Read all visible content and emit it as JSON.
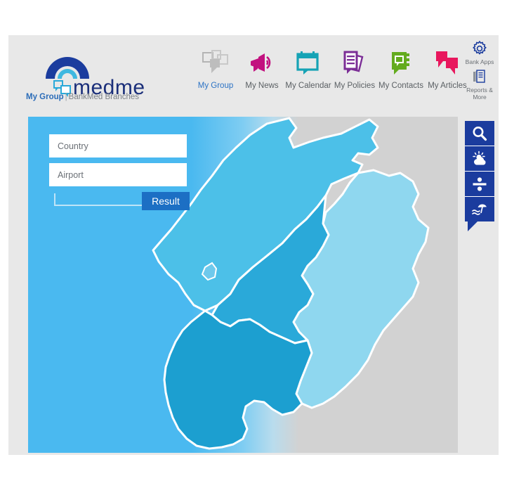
{
  "brand": {
    "name": "medme",
    "logo_icon": "arc-logo-icon",
    "chat_icon": "chat-bubbles-icon",
    "accent_color": "#1b2f7a"
  },
  "breadcrumb": {
    "active": "My Group",
    "separator": "|",
    "rest": "BankMed Branches"
  },
  "topnav": {
    "items": [
      {
        "label": "My Group",
        "icon": "group-squares-icon",
        "color": "#b0b0b0",
        "active": true
      },
      {
        "label": "My News",
        "icon": "megaphone-icon",
        "color": "#c2117f",
        "active": false
      },
      {
        "label": "My Calendar",
        "icon": "calendar-icon",
        "color": "#16a3b5",
        "active": false
      },
      {
        "label": "My Policies",
        "icon": "documents-icon",
        "color": "#7b2d96",
        "active": false
      },
      {
        "label": "My Contacts",
        "icon": "address-book-icon",
        "color": "#63ab1e",
        "active": false
      },
      {
        "label": "My Articles",
        "icon": "speech-bubbles-icon",
        "color": "#e8175d",
        "active": false
      }
    ]
  },
  "utility": {
    "items": [
      {
        "label": "Bank Apps",
        "icon": "gear-icon"
      },
      {
        "label": "Reports & More",
        "icon": "reports-stack-icon"
      }
    ]
  },
  "side_rail": {
    "color": "#1b3c9e",
    "buttons": [
      {
        "name": "search",
        "icon": "search-icon"
      },
      {
        "name": "weather",
        "icon": "sun-cloud-icon"
      },
      {
        "name": "medical",
        "icon": "division-icon"
      },
      {
        "name": "travel",
        "icon": "beach-umbrella-icon"
      }
    ]
  },
  "search_panel": {
    "country": {
      "value": "",
      "placeholder": "Country"
    },
    "airport": {
      "value": "",
      "placeholder": "Airport"
    },
    "result_label": "Result"
  },
  "map": {
    "title": "Lebanon regions map",
    "sea_color": "#4ab9f0",
    "land_color": "#d2d2d2",
    "regions": [
      {
        "name": "north",
        "color": "#4cc0e8"
      },
      {
        "name": "baalbek-hermel",
        "color": "#8fd7ef"
      },
      {
        "name": "mount-lebanon",
        "color": "#2aa9d9"
      },
      {
        "name": "south",
        "color": "#1c9fd0"
      },
      {
        "name": "bekaa",
        "color": "#8fd7ef"
      }
    ]
  }
}
